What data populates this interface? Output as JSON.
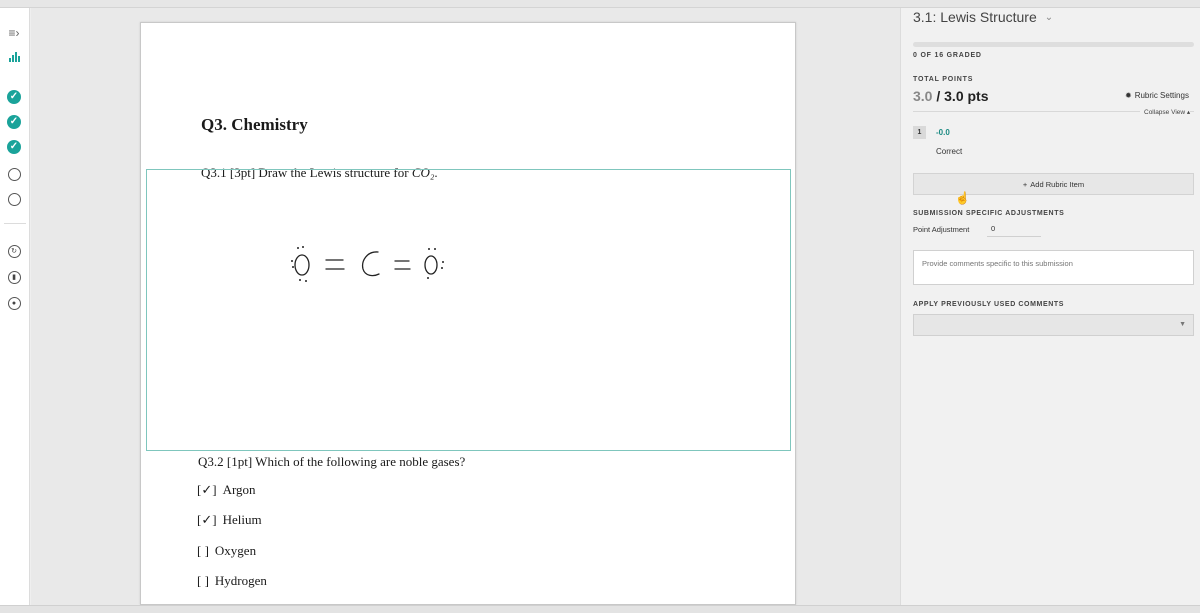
{
  "rail": {
    "icons": [
      "menu-collapse-icon",
      "statistics-icon",
      "check-circle-icon",
      "empty-circle-icon",
      "regrade-icon",
      "chart-icon",
      "settings-icon"
    ],
    "menu_glyph": "≡›"
  },
  "document": {
    "question_title": "Q3.  Chemistry",
    "q31_text": "Q3.1 [3pt] Draw the Lewis structure for ",
    "q31_formula": "CO₂",
    "q31_end": ".",
    "q32_text": "Q3.2 [1pt]  Which of the following are noble gases?",
    "choices": [
      {
        "box": "[✓]",
        "label": "Argon",
        "checked": true
      },
      {
        "box": "[✓]",
        "label": "Helium",
        "checked": true
      },
      {
        "box": "[ ]",
        "label": "Oxygen",
        "checked": false
      },
      {
        "box": "[ ]",
        "label": "Hydrogen",
        "checked": false
      }
    ]
  },
  "panel": {
    "question_name": "3.1: Lewis Structure",
    "graded_status": "0 OF 16 GRADED",
    "graded_fraction": 0,
    "total_points_label": "TOTAL POINTS",
    "score_earned": "3.0",
    "score_total": " / 3.0 pts",
    "rubric_settings_label": "Rubric Settings",
    "collapse_label": "Collapse View ▴",
    "rubric_items": [
      {
        "key": "1",
        "points": "-0.0",
        "description": "Correct"
      }
    ],
    "add_rubric_label": "Add Rubric Item",
    "adjustments_label": "SUBMISSION SPECIFIC ADJUSTMENTS",
    "point_adjustment_label": "Point Adjustment",
    "point_adjustment_value": "0",
    "comment_placeholder": "Provide comments specific to this submission",
    "previous_comments_label": "APPLY PREVIOUSLY USED COMMENTS"
  },
  "colors": {
    "accent": "#1aa39a",
    "answer_box_border": "#7fc6bd"
  }
}
